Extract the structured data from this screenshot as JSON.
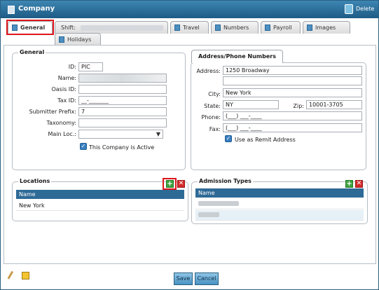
{
  "window": {
    "title": "Company",
    "delete_label": "Delete"
  },
  "tabs": [
    {
      "label": "General",
      "active": true,
      "highlighted": true
    },
    {
      "label": "Shift:",
      "active": false,
      "blurred_value": true
    },
    {
      "label": "Travel",
      "active": false
    },
    {
      "label": "Numbers",
      "active": false
    },
    {
      "label": "Payroll",
      "active": false
    },
    {
      "label": "Images",
      "active": false
    },
    {
      "label": "Holidays",
      "active": false
    }
  ],
  "general": {
    "legend": "General",
    "fields": {
      "id": {
        "label": "ID:",
        "value": "PIC"
      },
      "name": {
        "label": "Name:",
        "value": ""
      },
      "oasis_id": {
        "label": "Oasis ID:",
        "value": ""
      },
      "tax_id": {
        "label": "Tax ID:",
        "value": "__-_______"
      },
      "submitter_prefix": {
        "label": "Submitter Prefix:",
        "value": "7"
      },
      "taxonomy": {
        "label": "Taxonomy:",
        "value": ""
      },
      "main_loc": {
        "label": "Main Loc.:",
        "value": ""
      }
    },
    "active_checkbox": {
      "label": "This Company is Active",
      "checked": true
    }
  },
  "address": {
    "tab_label": "Address/Phone Numbers",
    "fields": {
      "address1": {
        "label": "Address:",
        "value": "1250 Broadway"
      },
      "address2": {
        "value": ""
      },
      "city": {
        "label": "City:",
        "value": "New York"
      },
      "state": {
        "label": "State:",
        "value": "NY"
      },
      "zip": {
        "label": "Zip:",
        "value": "10001-3705"
      },
      "phone": {
        "label": "Phone:",
        "value": "(___) ___-____"
      },
      "fax": {
        "label": "Fax:",
        "value": "(___) ___-____"
      }
    },
    "remit_checkbox": {
      "label": "Use as Remit Address",
      "checked": true
    }
  },
  "locations": {
    "legend": "Locations",
    "columns": [
      "Name"
    ],
    "rows": [
      "New York"
    ]
  },
  "admission_types": {
    "legend": "Admission Types",
    "columns": [
      "Name"
    ],
    "rows": [
      "",
      ""
    ]
  },
  "footer": {
    "save_label": "Save",
    "cancel_label": "Cancel"
  },
  "icons": {
    "title": "building-icon",
    "delete": "recycle-bin-icon",
    "tab": "page-icon",
    "add": "plus-icon",
    "remove": "x-icon",
    "edit": "pencil-icon",
    "note": "note-icon"
  },
  "colors": {
    "titlebar": "#1d5b85",
    "grid_header": "#2e6a96",
    "highlight": "#e0151b",
    "add_button": "#3ea33e",
    "delete_button": "#d42b2b",
    "checkbox": "#3a7fc0"
  }
}
